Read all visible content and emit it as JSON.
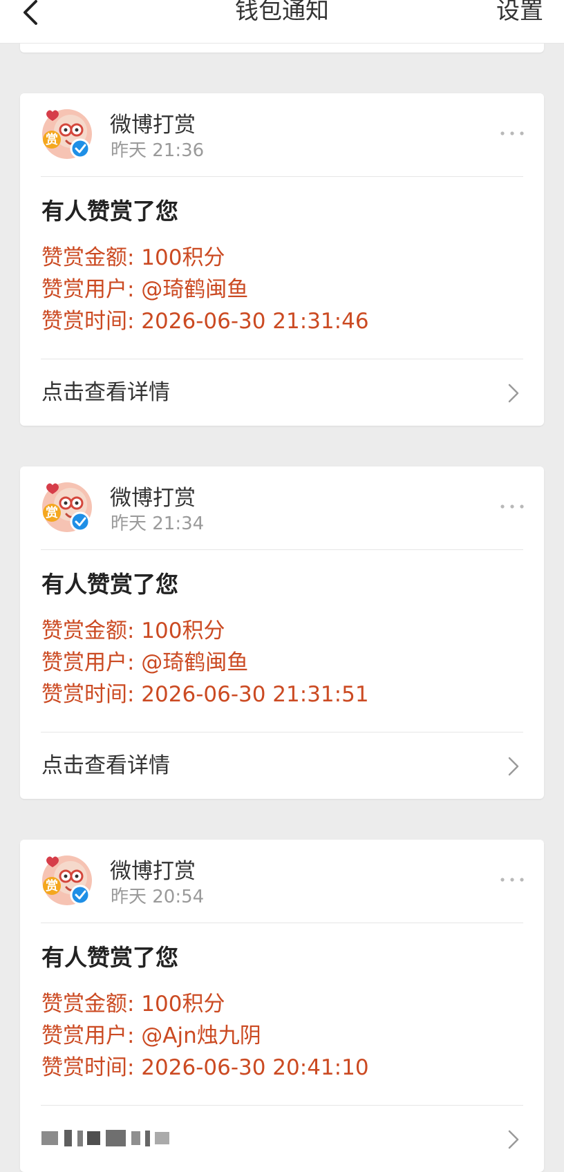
{
  "nav": {
    "title": "钱包通知",
    "settings_label": "设置",
    "back_icon": "chevron-left-icon"
  },
  "colors": {
    "page_background": "#ececec",
    "card_background": "#ffffff",
    "accent_red": "#cb4a22",
    "muted_text": "#9a9a9a",
    "verified_blue": "#1f8fe6"
  },
  "notifications": [
    {
      "sender": "微博打赏",
      "time": "昨天 21:36",
      "title": "有人赞赏了您",
      "amount": "赞赏金额: 100积分",
      "user": "赞赏用户: @琦鹤闽鱼",
      "reward_time": "赞赏时间: 2026-06-30 21:31:46",
      "action_label": "点击查看详情"
    },
    {
      "sender": "微博打赏",
      "time": "昨天 21:34",
      "title": "有人赞赏了您",
      "amount": "赞赏金额: 100积分",
      "user": "赞赏用户: @琦鹤闽鱼",
      "reward_time": "赞赏时间: 2026-06-30 21:31:51",
      "action_label": "点击查看详情"
    },
    {
      "sender": "微博打赏",
      "time": "昨天 20:54",
      "title": "有人赞赏了您",
      "amount": "赞赏金额: 100积分",
      "user": "赞赏用户: @Ajn烛九阴",
      "reward_time": "赞赏时间: 2026-06-30 20:41:10"
    }
  ],
  "icons": {
    "avatar": "weibo-reward-avatar",
    "verified": "verified-badge-icon",
    "avatar_badge_text": "赏",
    "more": "more-dots-icon",
    "chevron": "chevron-right-icon"
  }
}
